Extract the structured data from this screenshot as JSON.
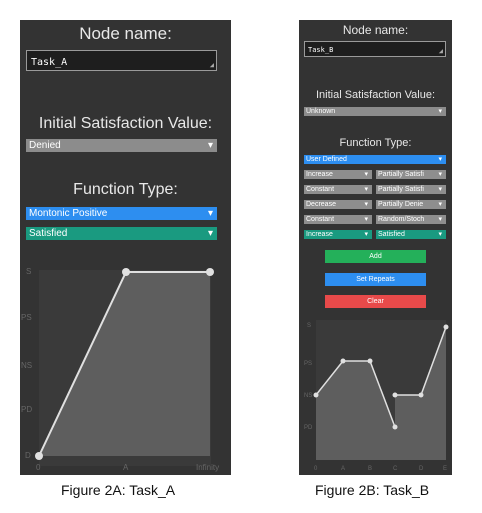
{
  "panel_a": {
    "node_name_label": "Node name:",
    "node_name_value": "Task_A",
    "initial_satisfaction_label": "Initial Satisfaction Value:",
    "initial_satisfaction_value": "Denied",
    "function_type_label": "Function Type:",
    "function_type_value": "Montonic Positive",
    "satisfaction_value": "Satisfied",
    "chart": {
      "y_ticks": [
        "S",
        "PS",
        "NS",
        "PD",
        "D"
      ],
      "x_ticks": [
        "0",
        "A",
        "Infinity"
      ]
    },
    "caption": "Figure 2A: Task_A"
  },
  "panel_b": {
    "node_name_label": "Node name:",
    "node_name_value": "Task_B",
    "initial_satisfaction_label": "Initial Satisfaction Value:",
    "initial_satisfaction_value": "Unknown",
    "function_type_label": "Function Type:",
    "function_type_value": "User Defined",
    "segments": [
      {
        "func": "Increase",
        "sat": "Partially Satisfi"
      },
      {
        "func": "Constant",
        "sat": "Partially Satisfi"
      },
      {
        "func": "Decrease",
        "sat": "Partially Denie"
      },
      {
        "func": "Constant",
        "sat": "Random/Stoch"
      },
      {
        "func": "Increase",
        "sat": "Satisfied"
      }
    ],
    "add_label": "Add",
    "set_repeats_label": "Set Repeats",
    "clear_label": "Clear",
    "chart": {
      "y_ticks": [
        "S",
        "PS",
        "NS",
        "PD"
      ],
      "x_ticks": [
        "0",
        "A",
        "B",
        "C",
        "D",
        "E"
      ]
    },
    "caption": "Figure 2B: Task_B"
  },
  "colors": {
    "panel_bg": "#333333",
    "select_gray": "#8c8c8c",
    "select_blue": "#2d8ef0",
    "select_teal": "#1a9a80",
    "button_green": "#24b05a",
    "button_blue": "#2d8ef0",
    "button_red": "#e84a4a"
  },
  "icons": [
    "dropdown-arrow-icon",
    "resize-grip-icon"
  ]
}
